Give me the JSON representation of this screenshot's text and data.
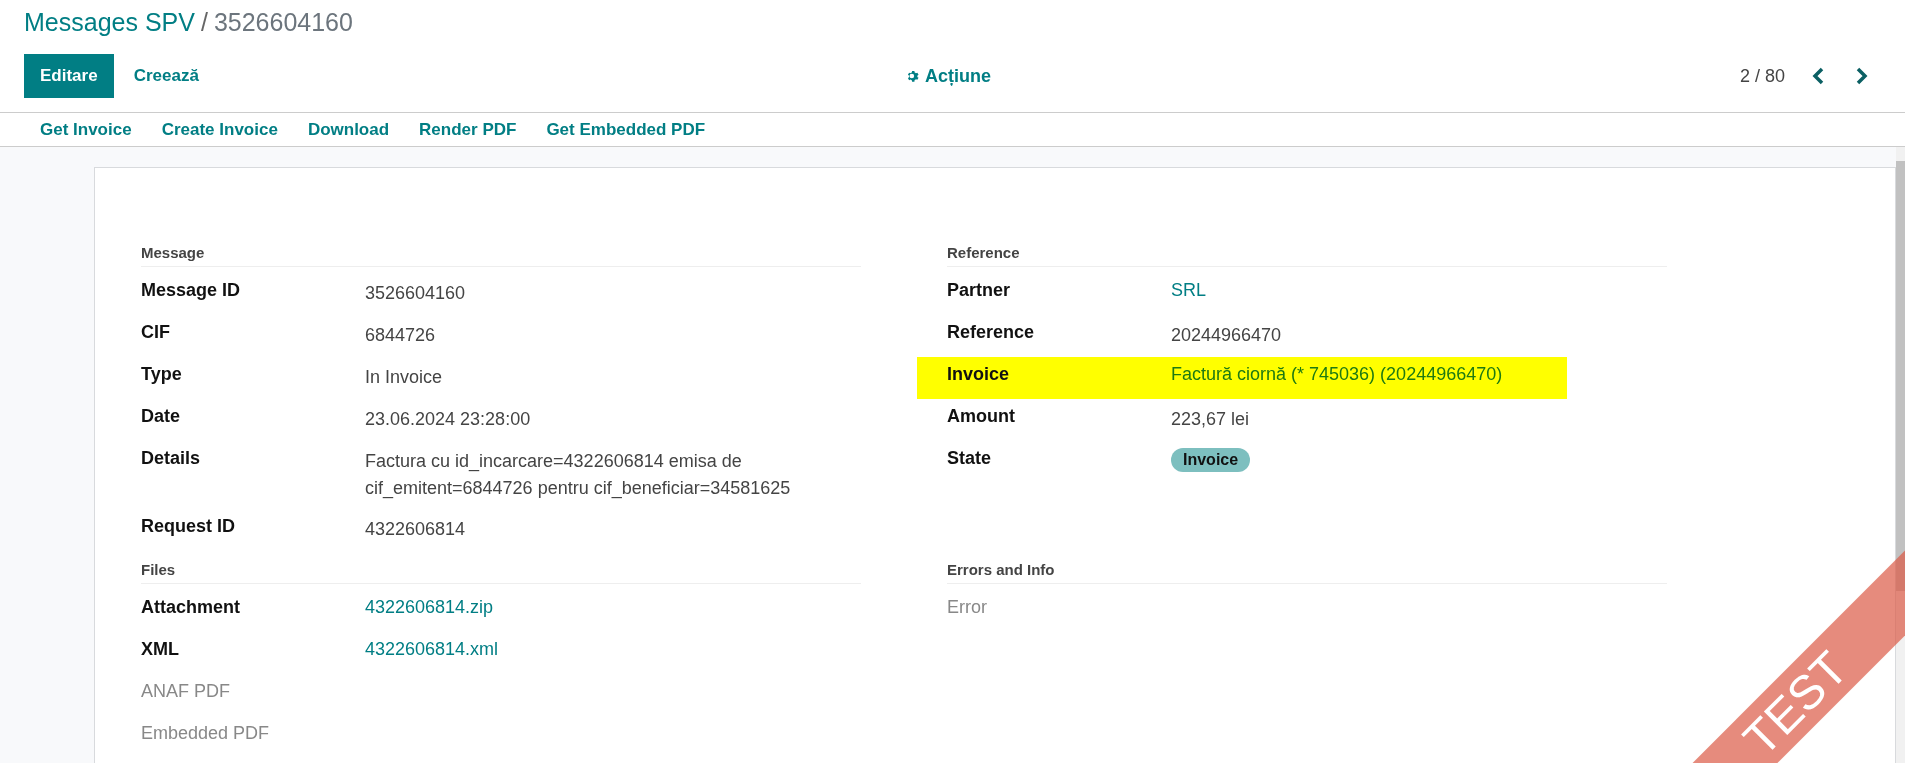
{
  "breadcrumb": {
    "parent": "Messages SPV",
    "separator": "/",
    "current": "3526604160"
  },
  "actions": {
    "primary": "Editare",
    "secondary": "Creează",
    "menu": "Acțiune"
  },
  "pager": {
    "value": "2 / 80"
  },
  "header_buttons": [
    "Get Invoice",
    "Create Invoice",
    "Download",
    "Render PDF",
    "Get Embedded PDF"
  ],
  "groups": [
    {
      "title": "Message",
      "fields": [
        {
          "label": "Message ID",
          "value": "3526604160",
          "kind": "text",
          "muted": false,
          "highlighted": false
        },
        {
          "label": "CIF",
          "value": "6844726",
          "kind": "text",
          "muted": false,
          "highlighted": false
        },
        {
          "label": "Type",
          "value": "In Invoice",
          "kind": "text",
          "muted": false,
          "highlighted": false
        },
        {
          "label": "Date",
          "value": "23.06.2024 23:28:00",
          "kind": "text",
          "muted": false,
          "highlighted": false
        },
        {
          "label": "Details",
          "value": "Factura cu id_incarcare=4322606814 emisa de cif_emitent=6844726 pentru cif_beneficiar=34581625",
          "kind": "text",
          "muted": false,
          "highlighted": false
        },
        {
          "label": "Request ID",
          "value": "4322606814",
          "kind": "text",
          "muted": false,
          "highlighted": false
        }
      ]
    },
    {
      "title": "Reference",
      "fields": [
        {
          "label": "Partner",
          "value": "SRL",
          "kind": "link",
          "muted": false,
          "highlighted": false
        },
        {
          "label": "Reference",
          "value": "20244966470",
          "kind": "text",
          "muted": false,
          "highlighted": false
        },
        {
          "label": "Invoice",
          "value": "Factură ciornă (* 745036) (20244966470)",
          "kind": "link",
          "muted": false,
          "highlighted": true
        },
        {
          "label": "Amount",
          "value": "223,67 lei",
          "kind": "text",
          "muted": false,
          "highlighted": false
        },
        {
          "label": "State",
          "value": "Invoice",
          "kind": "badge",
          "muted": false,
          "highlighted": false
        }
      ]
    },
    {
      "title": "Files",
      "fields": [
        {
          "label": "Attachment",
          "value": "4322606814.zip",
          "kind": "link",
          "muted": false,
          "highlighted": false
        },
        {
          "label": "XML",
          "value": "4322606814.xml",
          "kind": "link",
          "muted": false,
          "highlighted": false
        },
        {
          "label": "ANAF PDF",
          "muted": true,
          "highlighted": false
        },
        {
          "label": "Embedded PDF",
          "muted": true,
          "highlighted": false
        }
      ]
    },
    {
      "title": "Errors and Info",
      "fields": [
        {
          "label": "Error",
          "muted": true,
          "highlighted": false
        }
      ]
    }
  ],
  "ribbon": "TEST"
}
